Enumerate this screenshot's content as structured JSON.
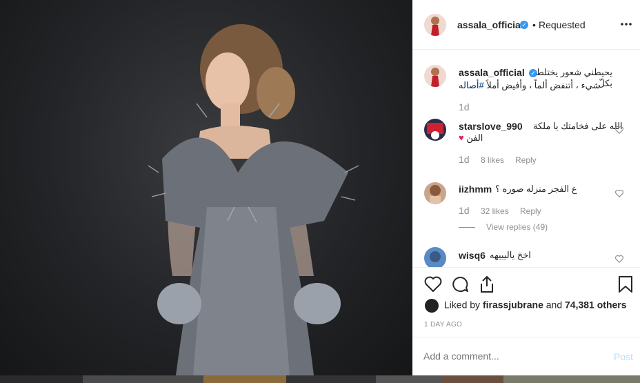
{
  "header": {
    "username": "assala_official",
    "separator": "•",
    "follow_status": "Requested",
    "more_icon": "more-horizontal-icon"
  },
  "caption": {
    "username": "assala_official",
    "text_line1": "يحيطني شعور يختلط بكلّ",
    "text_line2_plain": "شيء ، أتنفض ألماً ، وأفيض أملاً",
    "hashtag": "#أصاله",
    "time": "1d"
  },
  "comments": [
    {
      "username": "starslove_990",
      "text_line1": "الله على فخامتك يا ملكة",
      "text_line2": "الفن",
      "emoji": "♥",
      "time": "1d",
      "likes": "8 likes",
      "reply": "Reply"
    },
    {
      "username": "iizhmm",
      "text_line1": "ع الفجر منزله صوره ؟",
      "time": "1d",
      "likes": "32 likes",
      "reply": "Reply",
      "view_replies": "View replies (49)"
    },
    {
      "username": "wisq6",
      "text_line1": "اخخ ياليييهه"
    }
  ],
  "actions": {
    "like_icon": "heart-icon",
    "comment_icon": "comment-icon",
    "share_icon": "share-icon",
    "save_icon": "bookmark-icon"
  },
  "likes": {
    "prefix": "Liked by",
    "user": "firassjubrane",
    "middle": "and",
    "count": "74,381 others"
  },
  "timestamp": "1 DAY AGO",
  "add_comment": {
    "placeholder": "Add a comment...",
    "post_label": "Post"
  },
  "colors": {
    "blue": "#3897f0",
    "post_disabled": "#b2dffc",
    "text": "#262626",
    "muted": "#8e8e8e"
  }
}
